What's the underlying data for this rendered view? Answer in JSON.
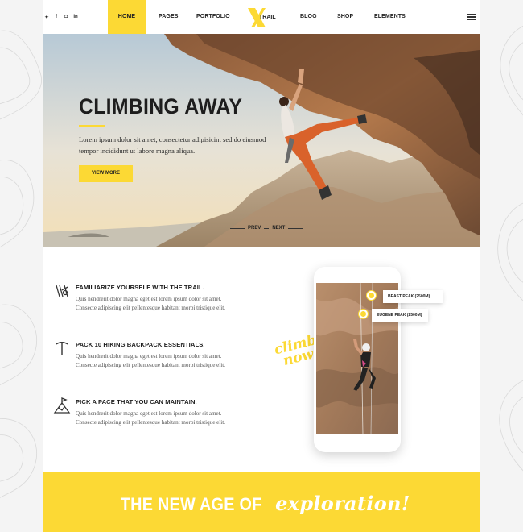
{
  "header": {
    "socials": [
      "twitter-icon",
      "facebook-icon",
      "instagram-icon",
      "linkedin-icon"
    ],
    "social_glyphs": [
      "✦",
      "f",
      "◘",
      "in"
    ],
    "nav_left": [
      "HOME",
      "PAGES",
      "PORTFOLIO"
    ],
    "nav_right": [
      "BLOG",
      "SHOP",
      "ELEMENTS"
    ],
    "logo_text": "TRAIL",
    "accent": "#fcd934"
  },
  "hero": {
    "title": "CLIMBING AWAY",
    "text": "Lorem ipsum dolor sit amet, consectetur adipisicint sed do eiusmod tempor incididunt ut labore magna aliqua.",
    "button": "VIEW MORE",
    "prev": "PREV",
    "next": "NEXT"
  },
  "features": [
    {
      "icon": "climbing-gear-icon",
      "title": "FAMILIARIZE YOURSELF WITH THE TRAIL.",
      "text": "Quis hendrerit dolor magna eget est lorem ipsum dolor sit amet. Consecte adipiscing elit pellentesque habitant morbi tristique elit."
    },
    {
      "icon": "ice-axe-icon",
      "title": "PACK 10 HIKING BACKPACK ESSENTIALS.",
      "text": "Quis hendrerit dolor magna eget est lorem ipsum dolor sit amet. Consecte adipiscing elit pellentesque habitant morbi tristique elit."
    },
    {
      "icon": "mountain-flag-icon",
      "title": "PICK A PACE THAT YOU CAN MAINTAIN.",
      "text": "Quis hendrerit dolor magna eget est lorem ipsum dolor sit amet. Consecte adipiscing elit pellentesque habitant morbi tristique elit."
    }
  ],
  "phone": {
    "callouts": [
      "BEAST PEAK (2500M)",
      "EUGENE PEAK (2500M)"
    ],
    "script_line1": "climb",
    "script_line2": "now"
  },
  "banner": {
    "text_plain": "THE NEW AGE OF",
    "text_script": "exploration!"
  }
}
